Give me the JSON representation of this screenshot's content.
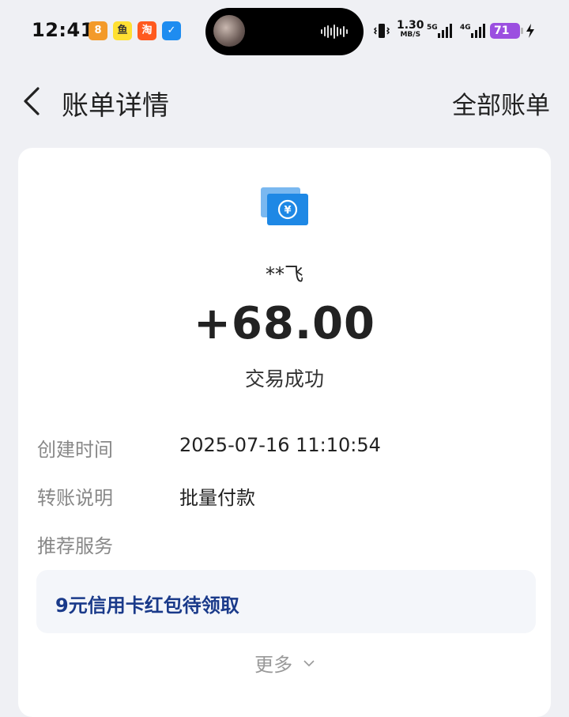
{
  "status_bar": {
    "time": "12:41",
    "apps": [
      "meituan-icon",
      "xianyu-icon",
      "taobao-icon",
      "feishu-icon"
    ],
    "net_speed": "1.30",
    "net_unit": "MB/S",
    "sig1_label": "5G",
    "sig2_label": "4G",
    "battery": "71"
  },
  "header": {
    "title": "账单详情",
    "right_action": "全部账单"
  },
  "transaction": {
    "counterparty": "**飞",
    "amount": "+68.00",
    "status": "交易成功",
    "details": [
      {
        "label": "创建时间",
        "value": "2025-07-16 11:10:54"
      },
      {
        "label": "转账说明",
        "value": "批量付款"
      },
      {
        "label": "推荐服务",
        "value": ""
      }
    ],
    "promo": "9元信用卡红包待领取",
    "more": "更多"
  },
  "colors": {
    "background": "#eff0f4",
    "card": "#ffffff",
    "promo_text": "#1a3a8a",
    "icon_blue": "#1e88e5",
    "battery": "#9b4fe0"
  }
}
